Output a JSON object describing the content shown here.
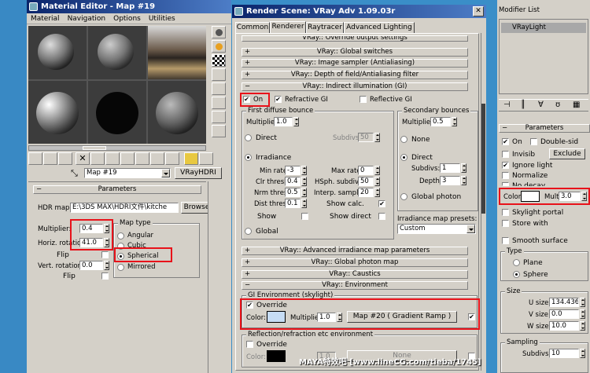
{
  "material_editor": {
    "title": "Material Editor - Map #19",
    "menu": [
      "Material",
      "Navigation",
      "Options",
      "Utilities"
    ],
    "map_name": "Map #19",
    "map_type_button": "VRayHDRI",
    "rollout_title": "Parameters",
    "hdr_label": "HDR map:",
    "hdr_path": "E:\\3DS MAX\\HDRI文件\\kitche",
    "browse_label": "Browse",
    "multiplier_label": "Multiplier:",
    "multiplier_value": "0.4",
    "horiz_label": "Horiz. rotation:",
    "horiz_value": "41.0",
    "flip1_label": "Flip",
    "vert_label": "Vert. rotation:",
    "vert_value": "0.0",
    "flip2_label": "Flip",
    "maptype_title": "Map type",
    "map_types": [
      "Angular",
      "Cubic",
      "Spherical",
      "Mirrored"
    ],
    "selected_map_type": "Spherical"
  },
  "render_scene": {
    "title": "Render Scene: VRay Adv 1.09.03r",
    "tabs": [
      "Common",
      "Renderer",
      "Raytracer",
      "Advanced Lighting"
    ],
    "active_tab": "Renderer",
    "rollouts_top": [
      "VRay:: Override output settings",
      "VRay:: Global switches",
      "VRay:: Image sampler (Antialiasing)",
      "VRay:: Depth of field/Antialiasing filter",
      "VRay:: Indirect illumination (GI)"
    ],
    "gi_on_label": "On",
    "refractive_gi_label": "Refractive GI",
    "reflective_gi_label": "Reflective GI",
    "first_bounce_title": "First diffuse bounce",
    "first_mult_label": "Multiplier:",
    "first_mult_value": "1.0",
    "direct_label": "Direct",
    "subdivs_label": "Subdivs:",
    "subdivs_value": "50",
    "irradiance_label": "Irradiance",
    "min_rate_label": "Min rate:",
    "min_rate_value": "-3",
    "max_rate_label": "Max rate:",
    "max_rate_value": "0",
    "clr_thresh_label": "Clr thresh:",
    "clr_thresh_value": "0.4",
    "hsph_label": "HSph. subdivs:",
    "hsph_value": "50",
    "nrm_thresh_label": "Nrm thresh:",
    "nrm_thresh_value": "0.5",
    "interp_label": "Interp. samples:",
    "interp_value": "20",
    "dist_thresh_label": "Dist thresh:",
    "dist_thresh_value": "0.1",
    "show_calc_label": "Show calc.",
    "show_label": "Show",
    "show_direct_label": "Show direct",
    "global_label": "Global",
    "secondary_title": "Secondary bounces",
    "sec_mult_label": "Multiplier:",
    "sec_mult_value": "0.5",
    "none_label": "None",
    "sec_direct_label": "Direct",
    "sec_subdivs_label": "Subdivs:",
    "sec_subdivs_value": "1",
    "depth_label": "Depth:",
    "depth_value": "3",
    "global_photon_label": "Global photon",
    "presets_label": "Irradiance map presets:",
    "presets_value": "Custom",
    "rollouts_mid": [
      "VRay:: Advanced irradiance map parameters",
      "VRay:: Global photon map",
      "VRay:: Caustics",
      "VRay:: Environment"
    ],
    "env_gi_title": "GI Environment (skylight)",
    "override_label": "Override",
    "color_label": "Color:",
    "env_color": "#c6dcf4",
    "env_mult_label": "Multiplier:",
    "env_mult_value": "1.0",
    "env_map_button": "Map #20  ( Gradient Ramp )",
    "refl_title": "Reflection/refraction etc environment",
    "refl_override_label": "Override",
    "refl_color_label": "Color:",
    "refl_mult_value": "1.0",
    "refl_map_label": "None"
  },
  "modify_panel": {
    "modifier_list": "Modifier List",
    "vraylight_item": "VRayLight",
    "params_title": "Parameters",
    "on_label": "On",
    "double_label": "Double-sid",
    "invisible_label": "Invisib",
    "exclude_label": "Exclude",
    "ignore_light_label": "Ignore light",
    "normalize_label": "Normalize",
    "no_decay_label": "No decay",
    "color_label": "Color:",
    "mult_label": "Mult",
    "mult_value": "3.0",
    "skylight_label": "Skylight portal",
    "store_label": "Store with",
    "smooth_label": "Smooth surface",
    "type_title": "Type",
    "plane_label": "Plane",
    "sphere_label": "Sphere",
    "size_title": "Size",
    "u_label": "U size:",
    "u_value": "134.436",
    "v_label": "V size:",
    "v_value": "0.0",
    "w_label": "W size:",
    "w_value": "10.0",
    "sampling_title": "Sampling",
    "sampling_subdivs_label": "Subdivs:",
    "sampling_subdivs_value": "10"
  },
  "watermark": "MAYA特效吧 [www.lineCG.com/tieba/1745]",
  "colors": {
    "titlebar": "#0a246a",
    "highlight": "#e8121a",
    "face": "#d4d0c8"
  }
}
